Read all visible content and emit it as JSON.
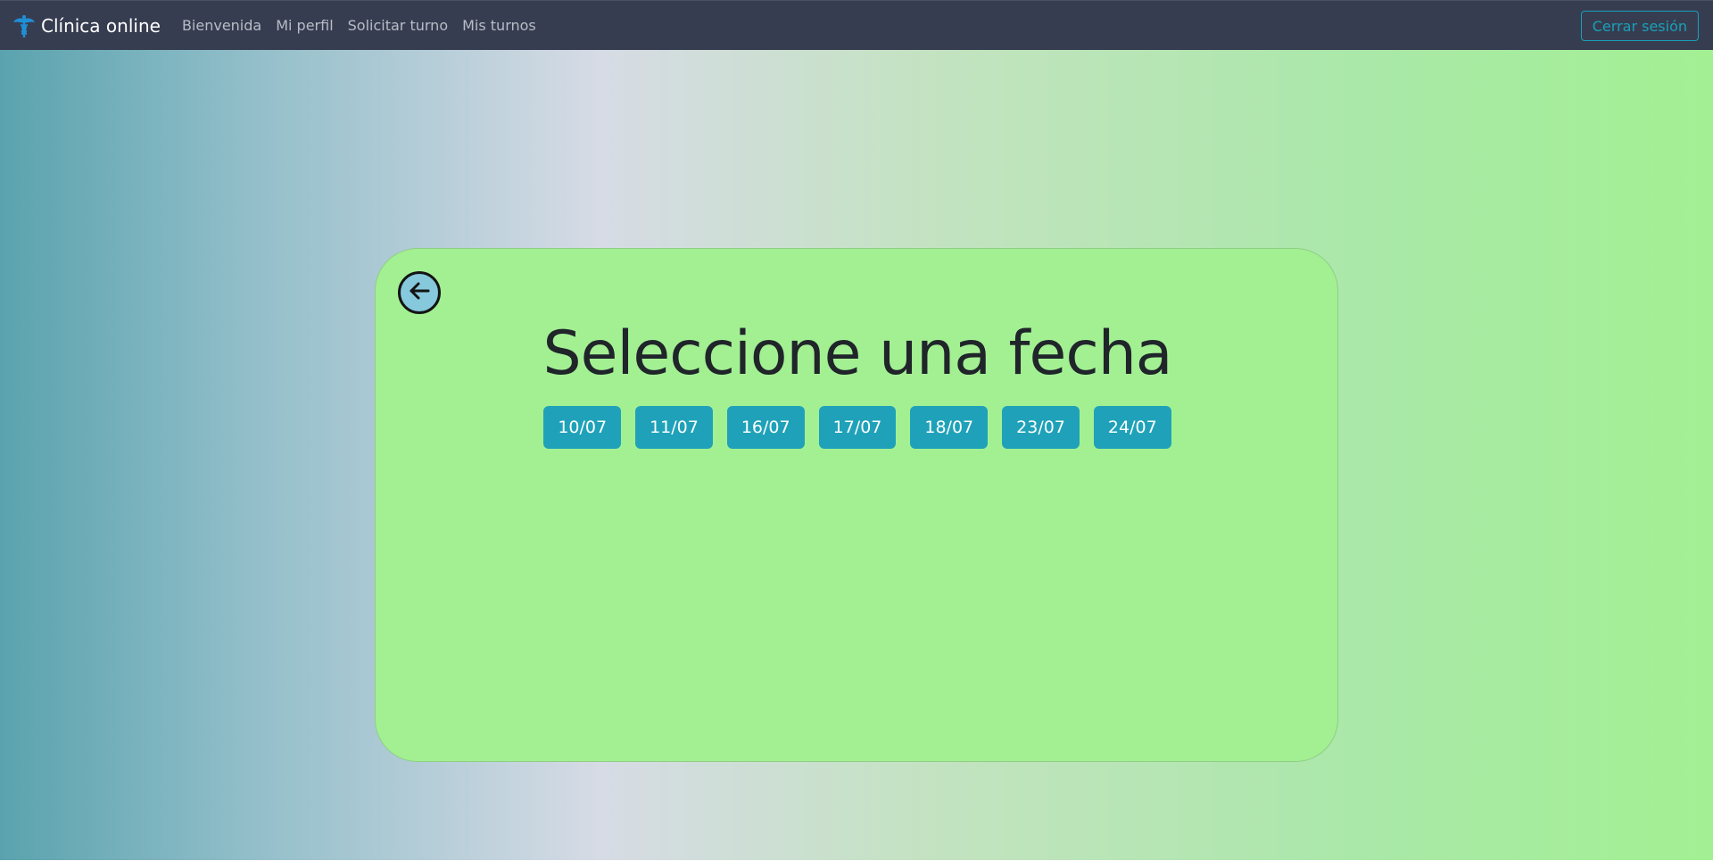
{
  "navbar": {
    "brand": "Clínica online",
    "links": [
      "Bienvenida",
      "Mi perfil",
      "Solicitar turno",
      "Mis turnos"
    ],
    "logout_label": "Cerrar sesión",
    "colors": {
      "background": "#373d50",
      "link": "#b7bcc6",
      "accent": "#18a0b8"
    }
  },
  "main": {
    "title": "Seleccione una fecha",
    "dates": [
      "10/07",
      "11/07",
      "16/07",
      "17/07",
      "18/07",
      "23/07",
      "24/07"
    ],
    "colors": {
      "card": "#a3f093",
      "date_button": "#1fa2b9",
      "back_button": "#86c8dc"
    }
  }
}
